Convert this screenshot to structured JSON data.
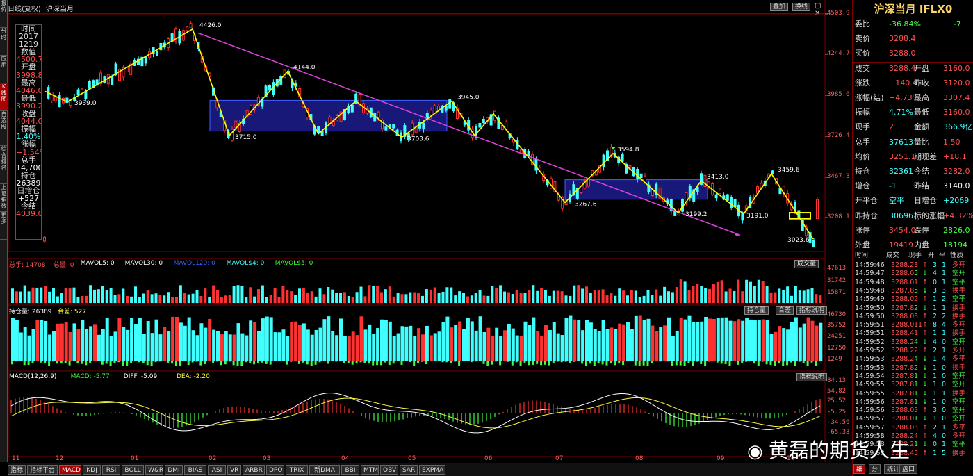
{
  "window": {
    "title": "日线(复权)",
    "instrument": "沪深当月",
    "top_buttons": [
      "叠加",
      "换线"
    ]
  },
  "left_nav": [
    "报价",
    "分时",
    "应用",
    "K线图",
    "自选股",
    "综合排名",
    "上证指数",
    "更多"
  ],
  "info_box": [
    {
      "t": "时间",
      "c": "#ddd"
    },
    {
      "t": "2017",
      "c": "#ddd"
    },
    {
      "t": "1219",
      "c": "#ddd"
    },
    {
      "t": "数值",
      "c": "#ddd"
    },
    {
      "t": "4500.7",
      "c": "#ff5050"
    },
    {
      "t": "开盘",
      "c": "#ddd"
    },
    {
      "t": "3998.8",
      "c": "#ff5050"
    },
    {
      "t": "最高",
      "c": "#ddd"
    },
    {
      "t": "4046.0",
      "c": "#ff5050"
    },
    {
      "t": "最低",
      "c": "#ddd"
    },
    {
      "t": "3990.2",
      "c": "#ff5050"
    },
    {
      "t": "收盘",
      "c": "#ddd"
    },
    {
      "t": "4044.0",
      "c": "#ff5050"
    },
    {
      "t": "振幅",
      "c": "#ddd"
    },
    {
      "t": "1.40%",
      "c": "#40ffff"
    },
    {
      "t": "涨幅",
      "c": "#ddd"
    },
    {
      "t": "+1.54%",
      "c": "#ff5050"
    },
    {
      "t": "总手",
      "c": "#ddd"
    },
    {
      "t": "14,700",
      "c": "#fff"
    },
    {
      "t": "持仓",
      "c": "#ddd"
    },
    {
      "t": "26389",
      "c": "#fff"
    },
    {
      "t": "日增仓",
      "c": "#ddd"
    },
    {
      "t": "+527",
      "c": "#fff"
    },
    {
      "t": "今结",
      "c": "#ddd"
    },
    {
      "t": "4039.0",
      "c": "#ff5050"
    }
  ],
  "price_axis": [
    "4503.9",
    "4244.7",
    "3985.6",
    "3726.4",
    "3467.3",
    "3208.1"
  ],
  "chart_labels": [
    {
      "t": "4426.0",
      "v": 4426
    },
    {
      "t": "3939.0",
      "v": 3939
    },
    {
      "t": "4144.0",
      "v": 4144
    },
    {
      "t": "3715.0",
      "v": 3715
    },
    {
      "t": "3945.0",
      "v": 3945
    },
    {
      "t": "3703.6",
      "v": 3703.6
    },
    {
      "t": "3594.8",
      "v": 3594.8
    },
    {
      "t": "3267.6",
      "v": 3267.6
    },
    {
      "t": "3413.0",
      "v": 3413
    },
    {
      "t": "3199.2",
      "v": 3199.2
    },
    {
      "t": "3459.6",
      "v": 3459.6
    },
    {
      "t": "3191.0",
      "v": 3191
    },
    {
      "t": "3023.6",
      "v": 3023.6
    }
  ],
  "volume_header": [
    {
      "t": "总手: 14708",
      "c": "#ff5050"
    },
    {
      "t": "总量: 0",
      "c": "#ff5050"
    },
    {
      "t": "MAVOL5: 0",
      "c": "#fff"
    },
    {
      "t": "MAVOL30: 0",
      "c": "#fff"
    },
    {
      "t": "MAVOL120: 0",
      "c": "#4060ff"
    },
    {
      "t": "MAVOL$4: 0",
      "c": "#40ffff"
    },
    {
      "t": "MAVOL$5: 0",
      "c": "#40ff40"
    }
  ],
  "volume_button": "成交量",
  "volume_axis": [
    "47613",
    "31742",
    "15871"
  ],
  "oi_header": [
    {
      "t": "持仓量: 26389",
      "c": "#fff"
    },
    {
      "t": "合差: 527",
      "c": "#ffff40"
    }
  ],
  "oi_buttons": [
    "持仓量",
    "合差",
    "指标说明"
  ],
  "oi_axis": [
    "46730",
    "35752",
    "24251",
    "12750",
    "1249"
  ],
  "macd_header": [
    {
      "t": "MACD(12,26,9)",
      "c": "#fff"
    },
    {
      "t": "MACD: -5.77",
      "c": "#40ff40"
    },
    {
      "t": "DIFF: -5.09",
      "c": "#fff"
    },
    {
      "t": "DEA: -2.20",
      "c": "#ffff40"
    }
  ],
  "macd_button": "指标说明",
  "macd_axis": [
    "84.13",
    "54.82",
    "25.52",
    "-5.25",
    "-34.56",
    "-65.33"
  ],
  "months": [
    "11",
    "12",
    "01",
    "02",
    "03",
    "04",
    "05",
    "06",
    "07",
    "08",
    "09",
    "10"
  ],
  "quote": {
    "title": "沪深当月 IFLX0",
    "rows": [
      [
        {
          "t": "委比",
          "c": "#ddd"
        },
        {
          "t": "-36.84%",
          "c": "#40ff40"
        },
        {
          "t": "-7",
          "c": "#40ff40"
        }
      ],
      [
        {
          "t": "卖价",
          "c": "#ddd"
        },
        {
          "t": "3288.4",
          "c": "#ff5050"
        },
        {
          "t": "",
          "c": "#ddd"
        }
      ],
      [
        {
          "t": "买价",
          "c": "#ddd"
        },
        {
          "t": "3288.0",
          "c": "#ff5050"
        },
        {
          "t": "",
          "c": "#ddd"
        }
      ],
      [
        {
          "t": "成交",
          "c": "#ddd"
        },
        {
          "t": "3288.4",
          "c": "#ff5050"
        },
        {
          "t": "开盘",
          "c": "#ddd"
        },
        {
          "t": "3160.0",
          "c": "#ff5050"
        }
      ],
      [
        {
          "t": "涨跌",
          "c": "#ddd"
        },
        {
          "t": "+140.4",
          "c": "#ff5050"
        },
        {
          "t": "昨收",
          "c": "#ddd"
        },
        {
          "t": "3120.0",
          "c": "#ff5050"
        }
      ],
      [
        {
          "t": "涨幅(结)",
          "c": "#ddd"
        },
        {
          "t": "+4.73%",
          "c": "#ff5050"
        },
        {
          "t": "最高",
          "c": "#ddd"
        },
        {
          "t": "3307.4",
          "c": "#ff5050"
        }
      ],
      [
        {
          "t": "振幅",
          "c": "#ddd"
        },
        {
          "t": "4.71%",
          "c": "#40ffff"
        },
        {
          "t": "最低",
          "c": "#ddd"
        },
        {
          "t": "3160.0",
          "c": "#ff5050"
        }
      ],
      [
        {
          "t": "现手",
          "c": "#ddd"
        },
        {
          "t": "2",
          "c": "#ff5050"
        },
        {
          "t": "金额",
          "c": "#ddd"
        },
        {
          "t": "366.9亿",
          "c": "#40ffff"
        }
      ],
      [
        {
          "t": "总手",
          "c": "#ddd"
        },
        {
          "t": "37613",
          "c": "#40ffff"
        },
        {
          "t": "量比",
          "c": "#ddd"
        },
        {
          "t": "1.50",
          "c": "#ff5050"
        }
      ],
      [
        {
          "t": "均价",
          "c": "#ddd"
        },
        {
          "t": "3251.1",
          "c": "#ff5050"
        },
        {
          "t": "期现差",
          "c": "#ddd"
        },
        {
          "t": "+18.1",
          "c": "#ff5050"
        }
      ],
      [
        {
          "t": "持仓",
          "c": "#ddd"
        },
        {
          "t": "32361",
          "c": "#40ffff"
        },
        {
          "t": "今结",
          "c": "#ddd"
        },
        {
          "t": "3282.0",
          "c": "#ff5050"
        }
      ],
      [
        {
          "t": "增仓",
          "c": "#ddd"
        },
        {
          "t": "-1",
          "c": "#40ffff"
        },
        {
          "t": "昨结",
          "c": "#ddd"
        },
        {
          "t": "3140.0",
          "c": "#fff"
        }
      ],
      [
        {
          "t": "开平仓",
          "c": "#ddd"
        },
        {
          "t": "空平",
          "c": "#40ffff"
        },
        {
          "t": "日增仓",
          "c": "#ddd"
        },
        {
          "t": "+2069",
          "c": "#40ffff"
        }
      ],
      [
        {
          "t": "昨持仓",
          "c": "#ddd"
        },
        {
          "t": "30696",
          "c": "#40ffff"
        },
        {
          "t": "标的涨幅",
          "c": "#ddd"
        },
        {
          "t": "+4.32%",
          "c": "#ff5050"
        }
      ],
      [
        {
          "t": "涨停",
          "c": "#ddd"
        },
        {
          "t": "3454.0",
          "c": "#ff5050"
        },
        {
          "t": "跌停",
          "c": "#ddd"
        },
        {
          "t": "2826.0",
          "c": "#40ff40"
        }
      ],
      [
        {
          "t": "外盘",
          "c": "#ddd"
        },
        {
          "t": "19419",
          "c": "#ff5050"
        },
        {
          "t": "内盘",
          "c": "#ddd"
        },
        {
          "t": "18194",
          "c": "#40ff40"
        }
      ]
    ]
  },
  "trades": {
    "headers": [
      "时间",
      "成交",
      "现手",
      "开",
      "平",
      "性质"
    ],
    "rows": [
      [
        "14:59:46",
        "3288.2",
        "3",
        "↑",
        "3",
        "1",
        "多开"
      ],
      [
        "14:59:47",
        "3288.0",
        "5",
        "↓",
        "4",
        "1",
        "空开"
      ],
      [
        "14:59:48",
        "3288.0",
        "1",
        "↑",
        "0",
        "1",
        "空平"
      ],
      [
        "14:59:48",
        "3287.8",
        "5",
        "↓",
        "3",
        "3",
        "换手"
      ],
      [
        "14:59:49",
        "3288.0",
        "2",
        "↑",
        "1",
        "2",
        "空平"
      ],
      [
        "14:59:50",
        "3287.8",
        "2",
        "↓",
        "1",
        "1",
        "换手"
      ],
      [
        "14:59:50",
        "3288.0",
        "3",
        "↑",
        "2",
        "2",
        "换手"
      ],
      [
        "14:59:51",
        "3288.0",
        "11",
        "↑",
        "8",
        "4",
        "多开"
      ],
      [
        "14:59:51",
        "3288.4",
        "1",
        "↑",
        "1",
        "1",
        "换手"
      ],
      [
        "14:59:52",
        "3288.2",
        "4",
        "↓",
        "4",
        "0",
        "空开"
      ],
      [
        "14:59:52",
        "3288.2",
        "2",
        "↑",
        "2",
        "1",
        "多开"
      ],
      [
        "14:59:53",
        "3288.2",
        "4",
        "↓",
        "1",
        "4",
        "多平"
      ],
      [
        "14:59:53",
        "3287.8",
        "2",
        "↓",
        "1",
        "0",
        "换手"
      ],
      [
        "14:59:54",
        "3287.8",
        "1",
        "↓",
        "1",
        "0",
        "空开"
      ],
      [
        "14:59:55",
        "3287.8",
        "1",
        "↓",
        "1",
        "0",
        "空开"
      ],
      [
        "14:59:55",
        "3287.8",
        "1",
        "↓",
        "1",
        "1",
        "换手"
      ],
      [
        "14:59:56",
        "3287.8",
        "1",
        "↓",
        "1",
        "0",
        "空开"
      ],
      [
        "14:59:56",
        "3288.0",
        "3",
        "↑",
        "3",
        "0",
        "空开"
      ],
      [
        "14:59:57",
        "3288.0",
        "1",
        "↓",
        "1",
        "0",
        "空开"
      ],
      [
        "14:59:57",
        "3288.0",
        "3",
        "↑",
        "2",
        "1",
        "多平"
      ],
      [
        "14:59:58",
        "3288.2",
        "4",
        "↑",
        "4",
        "0",
        "多开"
      ],
      [
        "14:59:58",
        "3288.2",
        "1",
        "↓",
        "0",
        "1",
        "空平"
      ],
      [
        "14:59:58",
        "3288.4",
        "5",
        "↑",
        "1",
        "5",
        "换手"
      ]
    ]
  },
  "rp_tabs": [
    "细",
    "分",
    "统计",
    "盘口"
  ],
  "bottom_tabs": [
    "指标",
    "指标平台",
    "MACD",
    "KDJ",
    "RSI",
    "BOLL",
    "W&R",
    "DMI",
    "BIAS",
    "ASI",
    "VR",
    "ARBR",
    "DPO",
    "TRIX",
    "新DMA",
    "BBI",
    "MTM",
    "OBV",
    "SAR",
    "EXPMA"
  ],
  "active_tab": "MACD",
  "watermark": "黄磊的期货人生",
  "colors": {
    "up": "#ff3232",
    "down": "#40ffff",
    "border": "#7a0000",
    "zigzag": "#ffff00",
    "trend": "#e040e0",
    "box": "#2020a0"
  }
}
